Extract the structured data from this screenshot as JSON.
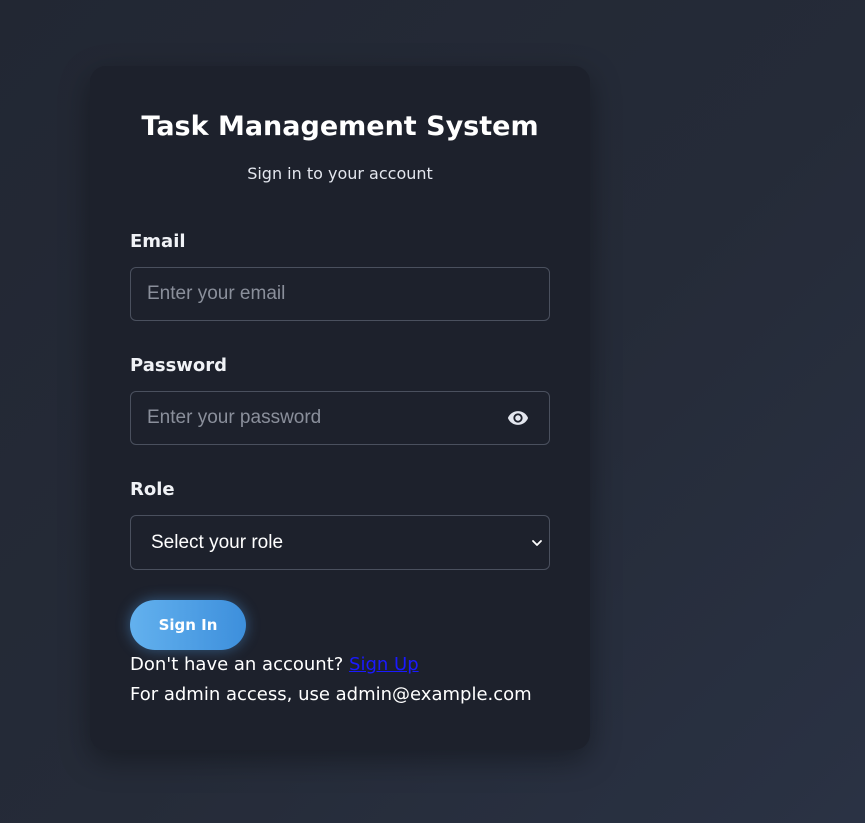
{
  "app": {
    "title": "Task Management System",
    "subtitle": "Sign in to your account"
  },
  "form": {
    "email": {
      "label": "Email",
      "value": "",
      "placeholder": "Enter your email"
    },
    "password": {
      "label": "Password",
      "value": "",
      "placeholder": "Enter your password",
      "toggle_icon": "eye-icon"
    },
    "role": {
      "label": "Role",
      "selected": "Select your role",
      "icon": "chevron-down-icon"
    },
    "submit_label": "Sign In"
  },
  "footer": {
    "signup_prompt": "Don't have an account? ",
    "signup_link": "Sign Up",
    "admin_note": "For admin access, use admin@example.com"
  },
  "colors": {
    "background": "#252b38",
    "card": "#1d212c",
    "accent": "#4fa3e8",
    "link": "#1a1aff"
  }
}
